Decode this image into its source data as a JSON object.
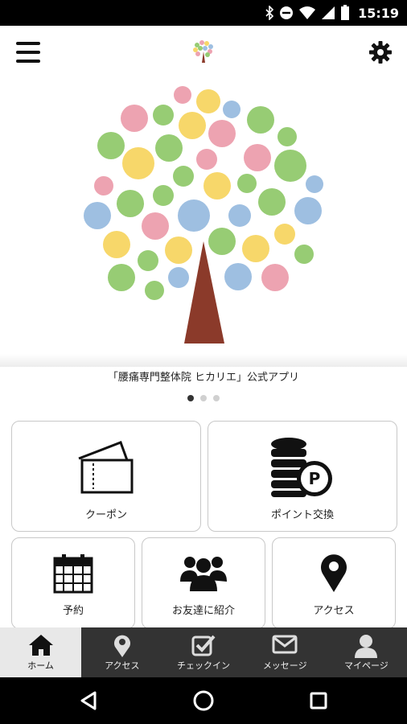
{
  "status_bar": {
    "time": "15:19",
    "icons": [
      "bluetooth-icon",
      "do-not-disturb-icon",
      "wifi-icon",
      "cellular-signal-icon",
      "battery-icon"
    ]
  },
  "header": {
    "menu_icon": "hamburger-menu-icon",
    "settings_icon": "gear-icon",
    "logo": "tree-logo"
  },
  "hero": {
    "caption": "「腰痛専門整体院 ヒカリエ」公式アプリ",
    "slide_count": 3,
    "active_slide": 1,
    "colors": {
      "pink": "#eda3b1",
      "yellow": "#f7d76a",
      "green": "#97cc74",
      "blue": "#9ebfe1",
      "trunk": "#8b3a2a"
    }
  },
  "tiles": [
    {
      "label": "クーポン",
      "icon": "ticket-icon"
    },
    {
      "label": "ポイント交換",
      "icon": "coin-stack-points-icon"
    },
    {
      "label": "予約",
      "icon": "calendar-icon"
    },
    {
      "label": "お友達に紹介",
      "icon": "group-people-icon"
    },
    {
      "label": "アクセス",
      "icon": "map-pin-icon"
    }
  ],
  "bottom_nav": [
    {
      "label": "ホーム",
      "icon": "home-icon",
      "active": true
    },
    {
      "label": "アクセス",
      "icon": "map-pin-icon",
      "active": false
    },
    {
      "label": "チェックイン",
      "icon": "checkbox-icon",
      "active": false
    },
    {
      "label": "メッセージ",
      "icon": "envelope-icon",
      "active": false
    },
    {
      "label": "マイページ",
      "icon": "user-icon",
      "active": false
    }
  ],
  "system_nav": [
    "back-icon",
    "home-circle-icon",
    "recents-icon"
  ],
  "colors": {
    "nav_bg": "#333333",
    "nav_active_bg": "#e8e8e8",
    "tile_border": "#c8c8c8"
  }
}
